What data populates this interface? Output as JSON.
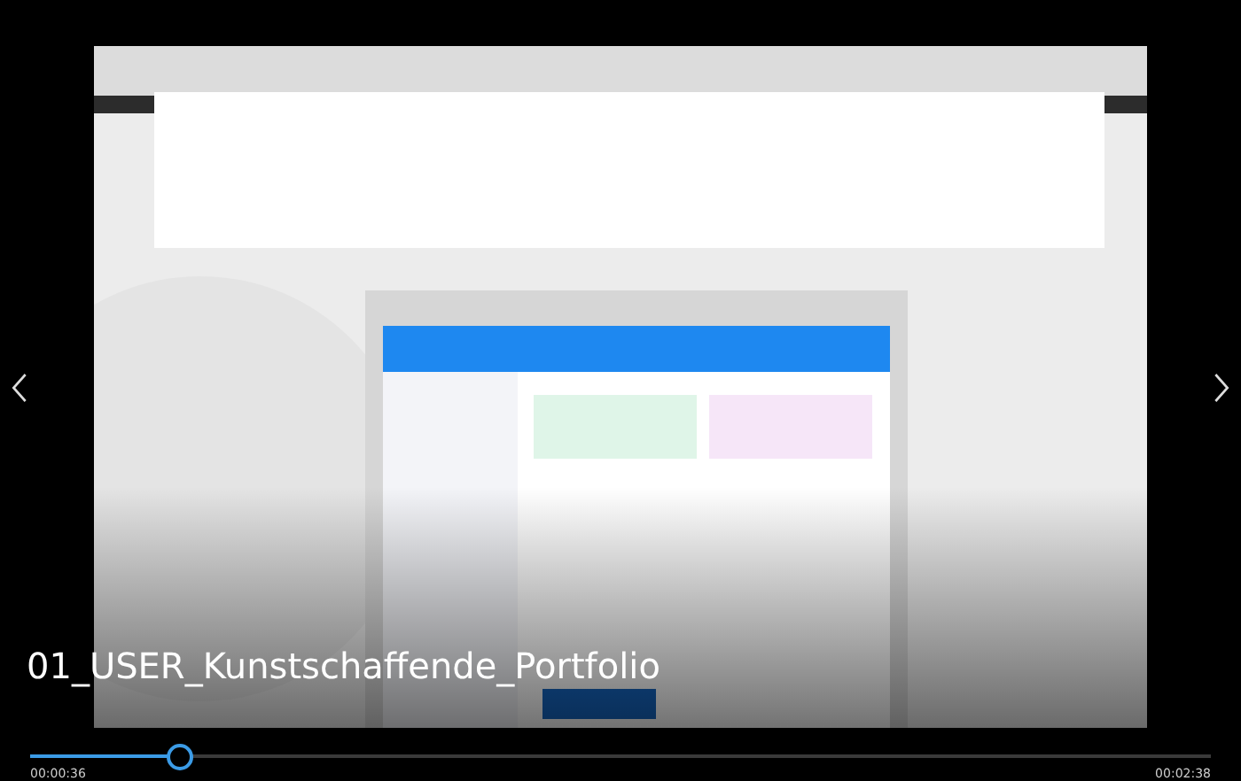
{
  "title": "01_USER_Kunstschaffende_Portfolio",
  "seek": {
    "level": 0.126
  },
  "elapsed": "00:00:36",
  "duration": "00:02:38"
}
